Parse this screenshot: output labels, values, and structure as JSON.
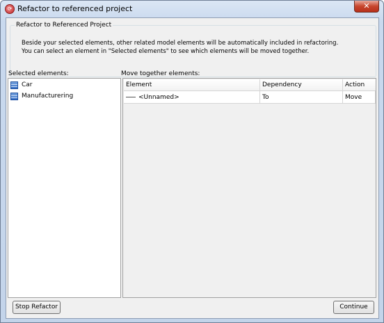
{
  "window": {
    "title": "Refactor to referenced project",
    "close_glyph": "✕",
    "app_icon": "vp-logo-icon"
  },
  "group": {
    "title": "Refactor to Referenced Project",
    "line1": "Beside your selected elements, other related model elements will be automatically included in refactoring.",
    "line2": "You can select an element in \"Selected elements\" to see which elements will be moved together."
  },
  "selected": {
    "label": "Selected elements:",
    "items": [
      {
        "label": "Car",
        "icon": "class-icon"
      },
      {
        "label": "Manufacturering",
        "icon": "class-icon"
      }
    ]
  },
  "move_together": {
    "label": "Move together elements:",
    "columns": [
      "Element",
      "Dependency",
      "Action"
    ],
    "rows": [
      {
        "element": "<Unnamed>",
        "dependency": "To",
        "action": "Move",
        "icon": "association-icon"
      }
    ]
  },
  "buttons": {
    "stop": "Stop Refactor",
    "continue": "Continue"
  },
  "colors": {
    "titlebar": "#c9d9ee",
    "close": "#c7452d",
    "client": "#f0f0f0"
  }
}
